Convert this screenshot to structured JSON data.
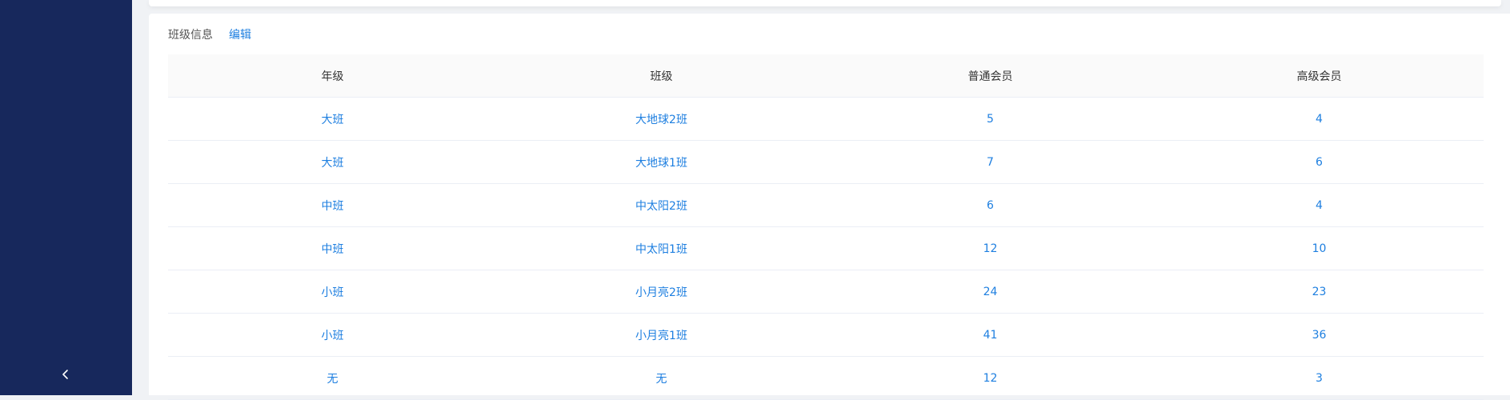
{
  "sidebar": {
    "collapse_icon": "chevron-left-icon",
    "bg_color": "#17285c"
  },
  "class_info": {
    "title": "班级信息",
    "edit_label": "编辑",
    "columns": [
      "年级",
      "班级",
      "普通会员",
      "高级会员"
    ],
    "rows": [
      {
        "grade": "大班",
        "class_name": "大地球2班",
        "regular": "5",
        "premium": "4"
      },
      {
        "grade": "大班",
        "class_name": "大地球1班",
        "regular": "7",
        "premium": "6"
      },
      {
        "grade": "中班",
        "class_name": "中太阳2班",
        "regular": "6",
        "premium": "4"
      },
      {
        "grade": "中班",
        "class_name": "中太阳1班",
        "regular": "12",
        "premium": "10"
      },
      {
        "grade": "小班",
        "class_name": "小月亮2班",
        "regular": "24",
        "premium": "23"
      },
      {
        "grade": "小班",
        "class_name": "小月亮1班",
        "regular": "41",
        "premium": "36"
      },
      {
        "grade": "无",
        "class_name": "无",
        "regular": "12",
        "premium": "3"
      }
    ],
    "link_color": "#1e7fe0"
  }
}
